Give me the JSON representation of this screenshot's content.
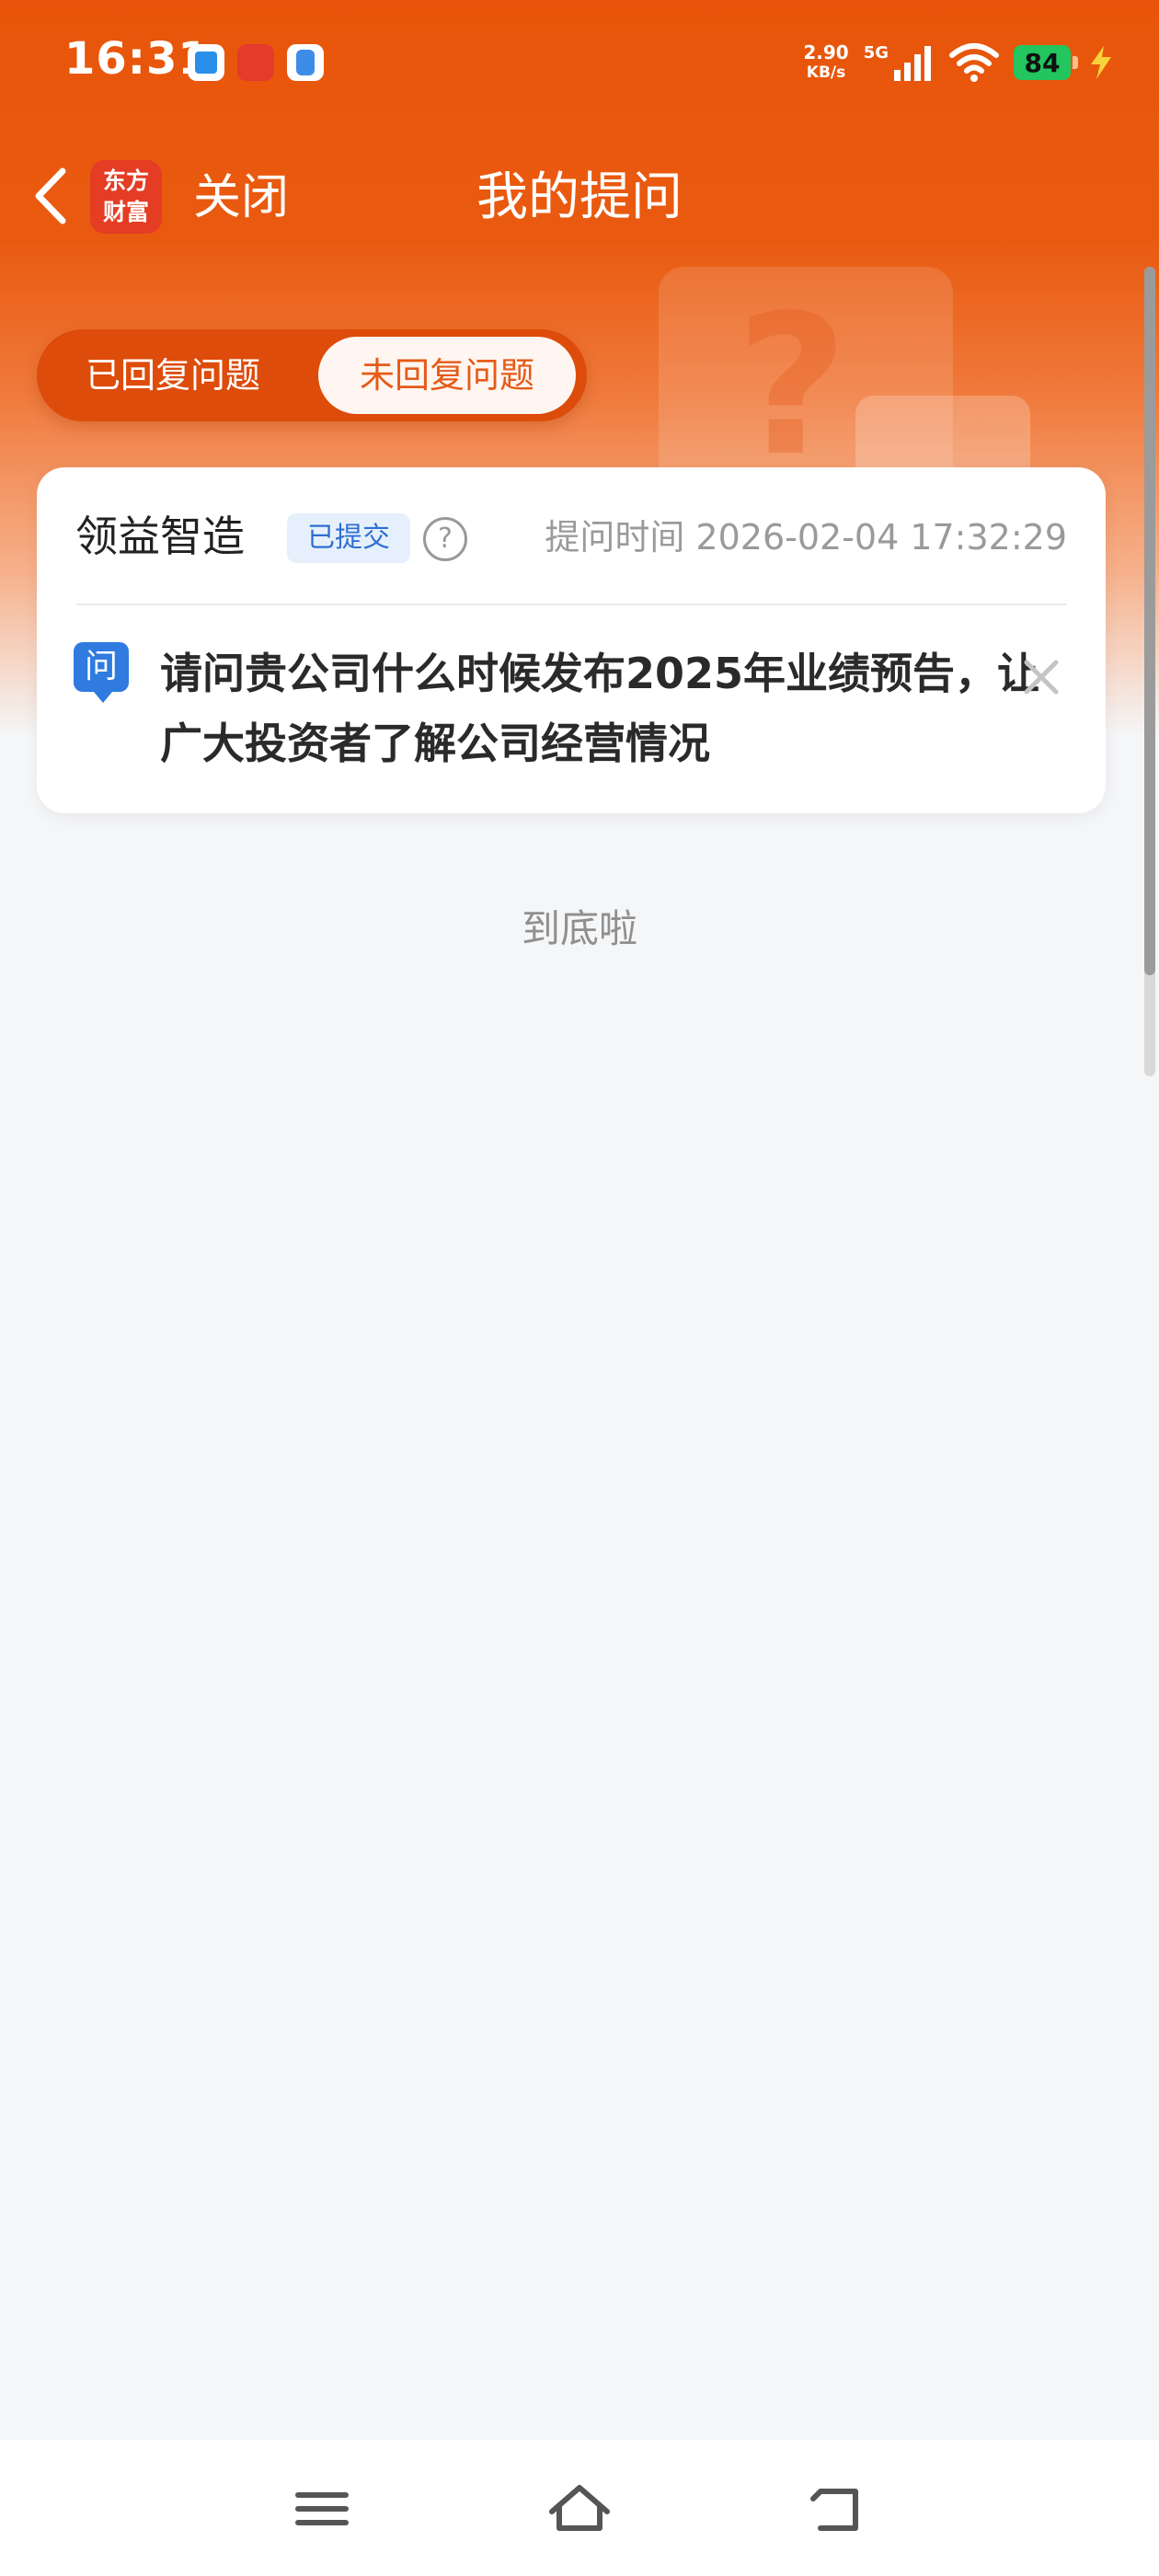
{
  "status_bar": {
    "time": "16:31",
    "net_speed_value": "2.90",
    "net_speed_unit": "KB/s",
    "network": "5G",
    "battery": "84",
    "apps": [
      {
        "icon": "blue-app-icon",
        "color": "#2a8fe8"
      },
      {
        "icon": "red-news-app-icon",
        "color": "#e43b2c"
      },
      {
        "icon": "blue-bag-app-icon",
        "color": "#3d8de8"
      }
    ]
  },
  "nav": {
    "logo_line1": "东方",
    "logo_line2": "财富",
    "close_label": "关闭",
    "title": "我的提问"
  },
  "tabs": [
    {
      "label": "已回复问题",
      "active": false
    },
    {
      "label": "未回复问题",
      "active": true
    }
  ],
  "card": {
    "company": "领益智造",
    "status_badge": "已提交",
    "help_icon": "?",
    "ask_time": "提问时间 2026-02-04 17:32:29",
    "question_icon_text": "问",
    "question": "请问贵公司什么时候发布2025年业绩预告，让广大投资者了解公司经营情况"
  },
  "bottom_tip": "到底啦",
  "colors": {
    "brand_orange": "#e8550a",
    "badge_blue": "#2f6fd1",
    "question_icon_blue": "#2f7be0",
    "battery_green": "#22c55e"
  }
}
